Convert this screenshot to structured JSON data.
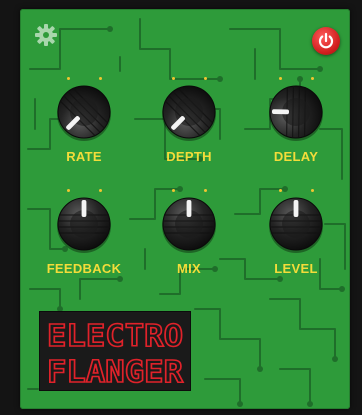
{
  "colors": {
    "board": "#2e9b3a",
    "trace": "#1f6e2a",
    "label": "#f3dc3a",
    "logo_text": "#e0222a",
    "power": "#d01e1e"
  },
  "header": {
    "settings_icon": "gear-icon",
    "power_icon": "power-icon"
  },
  "knobs": [
    {
      "label": "RATE",
      "value_fraction": 0.0
    },
    {
      "label": "DEPTH",
      "value_fraction": 0.0
    },
    {
      "label": "DELAY",
      "value_fraction": 0.17
    },
    {
      "label": "FEEDBACK",
      "value_fraction": 0.5
    },
    {
      "label": "MIX",
      "value_fraction": 0.5
    },
    {
      "label": "LEVEL",
      "value_fraction": 0.5
    }
  ],
  "logo": {
    "line1": "ELECTRO",
    "line2": "FLANGER"
  }
}
